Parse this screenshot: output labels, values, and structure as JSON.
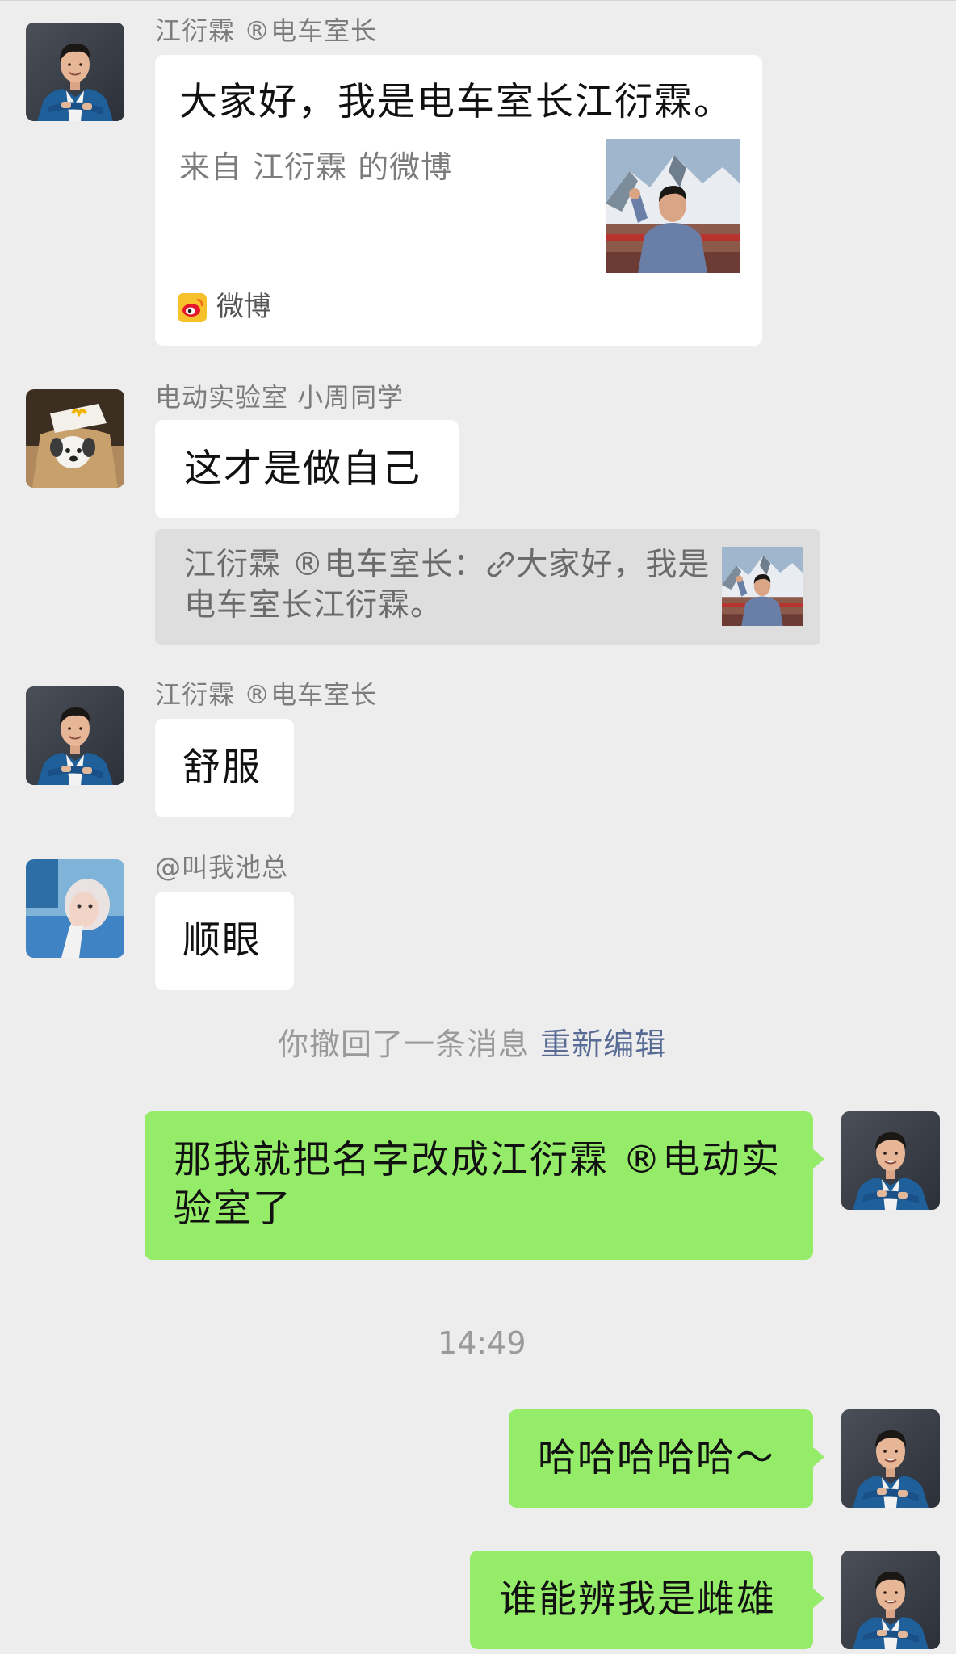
{
  "messages": {
    "m1": {
      "sender": "江衍霖 ®电车室长",
      "avatar": "avatar-man-blue-jacket",
      "card": {
        "title": "大家好，我是电车室长江衍霖。",
        "description": "来自 江衍霖 的微博",
        "thumbnail": "photo-man-in-snow-mountains",
        "source_icon": "weibo-logo-icon",
        "source": "微博"
      }
    },
    "m2": {
      "sender": "电动实验室 小周同学",
      "avatar": "avatar-plush-toy-bag",
      "text": "这才是做自己",
      "quote": {
        "prefix": "江衍霖 ®电车室长：",
        "link_icon": "link-icon",
        "line1_rest": "大家好，我是",
        "line2": "电车室长江衍霖。",
        "thumbnail": "photo-man-in-snow-mountains"
      }
    },
    "m3": {
      "sender": "江衍霖 ®电车室长",
      "avatar": "avatar-man-blue-jacket",
      "text": "舒服"
    },
    "m4": {
      "sender": "@叫我池总",
      "avatar": "avatar-woman-blue-sweater",
      "text": "顺眼"
    },
    "recall": {
      "text": "你撤回了一条消息",
      "action": "重新编辑"
    },
    "m5": {
      "avatar": "avatar-man-blue-jacket",
      "line1": "那我就把名字改成江衍霖 ®电动实",
      "line2": "验室了"
    },
    "timestamp": "14:49",
    "m6": {
      "avatar": "avatar-man-blue-jacket",
      "text": "哈哈哈哈哈～"
    },
    "m7": {
      "avatar": "avatar-man-blue-jacket",
      "text": "谁能辨我是雌雄"
    }
  },
  "colors": {
    "background": "#ededed",
    "bubble_in": "#ffffff",
    "bubble_out": "#95ec69",
    "link_blue": "#576b95",
    "gray_text": "#7c7c7c"
  }
}
